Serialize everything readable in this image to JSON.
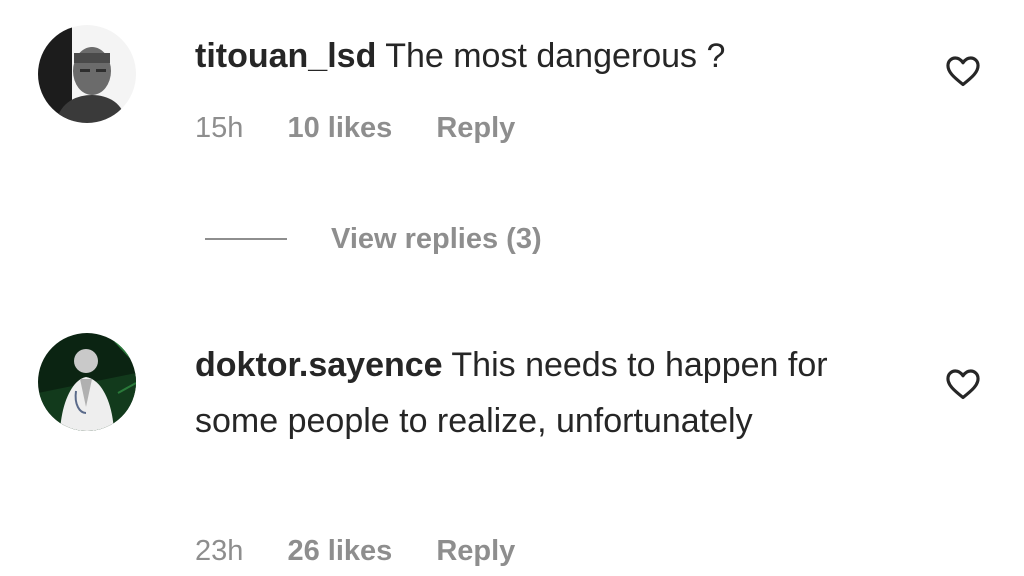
{
  "comments": [
    {
      "username": "titouan_lsd",
      "text": "The most dangerous ?",
      "time": "15h",
      "likes": "10 likes",
      "reply_label": "Reply",
      "avatar_icon": "user-avatar-portrait"
    },
    {
      "username": "doktor.sayence",
      "text": "This needs to happen for some people to realize, unfortunately",
      "time": "23h",
      "likes": "26 likes",
      "reply_label": "Reply",
      "avatar_icon": "user-avatar-doctor"
    }
  ],
  "view_replies": {
    "label": "View replies (3)"
  },
  "icons": {
    "like": "heart-outline-icon"
  },
  "colors": {
    "text": "#262626",
    "secondary": "#8e8e8e",
    "background": "#ffffff"
  }
}
